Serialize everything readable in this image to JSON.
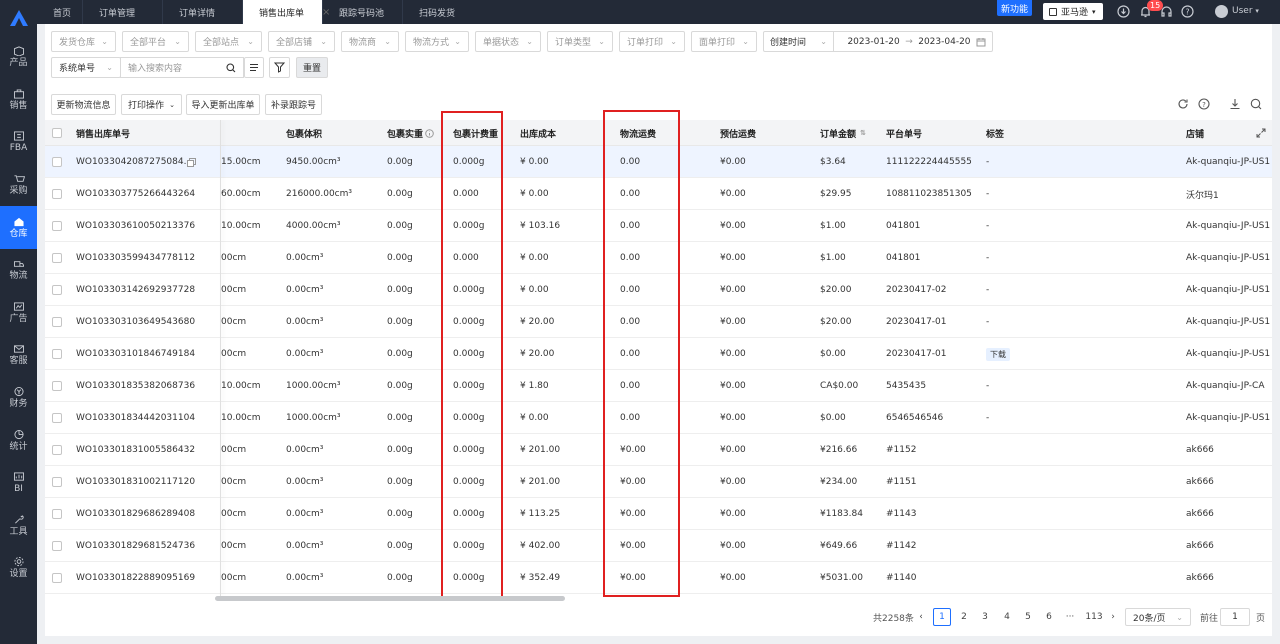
{
  "sidebar": {
    "items": [
      {
        "label": "产品",
        "icon": "product-icon"
      },
      {
        "label": "销售",
        "icon": "sales-icon"
      },
      {
        "label": "FBA",
        "icon": "fba-icon"
      },
      {
        "label": "采购",
        "icon": "purchase-icon"
      },
      {
        "label": "仓库",
        "icon": "warehouse-icon",
        "active": true
      },
      {
        "label": "物流",
        "icon": "logistics-icon"
      },
      {
        "label": "广告",
        "icon": "ads-icon"
      },
      {
        "label": "客服",
        "icon": "service-icon"
      },
      {
        "label": "财务",
        "icon": "finance-icon"
      },
      {
        "label": "统计",
        "icon": "stats-icon"
      },
      {
        "label": "BI",
        "icon": "bi-icon"
      },
      {
        "label": "工具",
        "icon": "tools-icon"
      },
      {
        "label": "设置",
        "icon": "settings-icon"
      }
    ]
  },
  "tabs": [
    {
      "label": "首页"
    },
    {
      "label": "订单管理"
    },
    {
      "label": "订单详情"
    },
    {
      "label": "销售出库单",
      "active": true
    },
    {
      "label": "跟踪号码池"
    },
    {
      "label": "扫码发货"
    }
  ],
  "topbar": {
    "new_feature": "新功能",
    "platform": "亚马逊",
    "notification_count": "15",
    "user": "User"
  },
  "filters": {
    "row1": [
      "发货仓库",
      "全部平台",
      "全部站点",
      "全部店铺",
      "物流商",
      "物流方式",
      "单据状态",
      "订单类型",
      "订单打印",
      "面单打印"
    ],
    "date_type": "创建时间",
    "date_start": "2023-01-20",
    "date_sep": "→",
    "date_end": "2023-04-20",
    "search_type": "系统单号",
    "search_placeholder": "输入搜索内容",
    "reset": "重置"
  },
  "actions": {
    "update_logistics": "更新物流信息",
    "print": "打印操作",
    "import": "导入更新出库单",
    "add_tracking": "补录跟踪号"
  },
  "table": {
    "headers": {
      "order_no": "销售出库单号",
      "volume": "包裹体积",
      "actual_weight": "包裹实重",
      "charge_weight": "包裹计费重",
      "cost": "出库成本",
      "freight": "物流运费",
      "est_freight": "预估运费",
      "amount": "订单金额",
      "platform_no": "平台单号",
      "tag": "标签",
      "store": "店铺"
    },
    "rows": [
      {
        "order_no": "WO1033042087275084...",
        "dim": "15.00cm",
        "volume": "9450.00cm³",
        "actual_weight": "0.00g",
        "charge_weight": "0.000g",
        "cost": "¥ 0.00",
        "freight": "0.00",
        "est_freight": "¥0.00",
        "amount": "$3.64",
        "platform_no": "111122224445555",
        "tag": "-",
        "store": "Ak-quanqiu-JP-US1"
      },
      {
        "order_no": "WO103303775266443264",
        "dim": "60.00cm",
        "volume": "216000.00cm³",
        "actual_weight": "0.00g",
        "charge_weight": "0.000",
        "cost": "¥ 0.00",
        "freight": "0.00",
        "est_freight": "¥0.00",
        "amount": "$29.95",
        "platform_no": "108811023851305",
        "tag": "-",
        "store": "沃尔玛1"
      },
      {
        "order_no": "WO103303610050213376",
        "dim": "10.00cm",
        "volume": "4000.00cm³",
        "actual_weight": "0.00g",
        "charge_weight": "0.000g",
        "cost": "¥ 103.16",
        "freight": "0.00",
        "est_freight": "¥0.00",
        "amount": "$1.00",
        "platform_no": "041801",
        "tag": "-",
        "store": "Ak-quanqiu-JP-US1"
      },
      {
        "order_no": "WO103303599434778112",
        "dim": "00cm",
        "volume": "0.00cm³",
        "actual_weight": "0.00g",
        "charge_weight": "0.000",
        "cost": "¥ 0.00",
        "freight": "0.00",
        "est_freight": "¥0.00",
        "amount": "$1.00",
        "platform_no": "041801",
        "tag": "-",
        "store": "Ak-quanqiu-JP-US1"
      },
      {
        "order_no": "WO103303142692937728",
        "dim": "00cm",
        "volume": "0.00cm³",
        "actual_weight": "0.00g",
        "charge_weight": "0.000g",
        "cost": "¥ 0.00",
        "freight": "0.00",
        "est_freight": "¥0.00",
        "amount": "$20.00",
        "platform_no": "20230417-02",
        "tag": "-",
        "store": "Ak-quanqiu-JP-US1"
      },
      {
        "order_no": "WO103303103649543680",
        "dim": "00cm",
        "volume": "0.00cm³",
        "actual_weight": "0.00g",
        "charge_weight": "0.000g",
        "cost": "¥ 20.00",
        "freight": "0.00",
        "est_freight": "¥0.00",
        "amount": "$20.00",
        "platform_no": "20230417-01",
        "tag": "-",
        "store": "Ak-quanqiu-JP-US1"
      },
      {
        "order_no": "WO103303101846749184",
        "dim": "00cm",
        "volume": "0.00cm³",
        "actual_weight": "0.00g",
        "charge_weight": "0.000g",
        "cost": "¥ 20.00",
        "freight": "0.00",
        "est_freight": "¥0.00",
        "amount": "$0.00",
        "platform_no": "20230417-01",
        "tag": "下载",
        "store": "Ak-quanqiu-JP-US1"
      },
      {
        "order_no": "WO103301835382068736",
        "dim": "10.00cm",
        "volume": "1000.00cm³",
        "actual_weight": "0.00g",
        "charge_weight": "0.000g",
        "cost": "¥ 1.80",
        "freight": "0.00",
        "est_freight": "¥0.00",
        "amount": "CA$0.00",
        "platform_no": "5435435",
        "tag": "-",
        "store": "Ak-quanqiu-JP-CA"
      },
      {
        "order_no": "WO103301834442031104",
        "dim": "10.00cm",
        "volume": "1000.00cm³",
        "actual_weight": "0.00g",
        "charge_weight": "0.000g",
        "cost": "¥ 0.00",
        "freight": "0.00",
        "est_freight": "¥0.00",
        "amount": "$0.00",
        "platform_no": "6546546546",
        "tag": "-",
        "store": "Ak-quanqiu-JP-US1"
      },
      {
        "order_no": "WO103301831005586432",
        "dim": "00cm",
        "volume": "0.00cm³",
        "actual_weight": "0.00g",
        "charge_weight": "0.000g",
        "cost": "¥ 201.00",
        "freight": "¥0.00",
        "est_freight": "¥0.00",
        "amount": "¥216.66",
        "platform_no": "#1152",
        "tag": "",
        "store": "ak666"
      },
      {
        "order_no": "WO103301831002117120",
        "dim": "00cm",
        "volume": "0.00cm³",
        "actual_weight": "0.00g",
        "charge_weight": "0.000g",
        "cost": "¥ 201.00",
        "freight": "¥0.00",
        "est_freight": "¥0.00",
        "amount": "¥234.00",
        "platform_no": "#1151",
        "tag": "",
        "store": "ak666"
      },
      {
        "order_no": "WO103301829686289408",
        "dim": "00cm",
        "volume": "0.00cm³",
        "actual_weight": "0.00g",
        "charge_weight": "0.000g",
        "cost": "¥ 113.25",
        "freight": "¥0.00",
        "est_freight": "¥0.00",
        "amount": "¥1183.84",
        "platform_no": "#1143",
        "tag": "",
        "store": "ak666"
      },
      {
        "order_no": "WO103301829681524736",
        "dim": "00cm",
        "volume": "0.00cm³",
        "actual_weight": "0.00g",
        "charge_weight": "0.000g",
        "cost": "¥ 402.00",
        "freight": "¥0.00",
        "est_freight": "¥0.00",
        "amount": "¥649.66",
        "platform_no": "#1142",
        "tag": "",
        "store": "ak666"
      },
      {
        "order_no": "WO103301822889095169",
        "dim": "00cm",
        "volume": "0.00cm³",
        "actual_weight": "0.00g",
        "charge_weight": "0.000g",
        "cost": "¥ 352.49",
        "freight": "¥0.00",
        "est_freight": "¥0.00",
        "amount": "¥5031.00",
        "platform_no": "#1140",
        "tag": "",
        "store": "ak666"
      }
    ]
  },
  "pagination": {
    "total": "共2258条",
    "pages": [
      "1",
      "2",
      "3",
      "4",
      "5",
      "6",
      "···",
      "113"
    ],
    "current": "1",
    "page_size": "20条/页",
    "goto_label": "前往",
    "goto_value": "1",
    "page_unit": "页"
  }
}
